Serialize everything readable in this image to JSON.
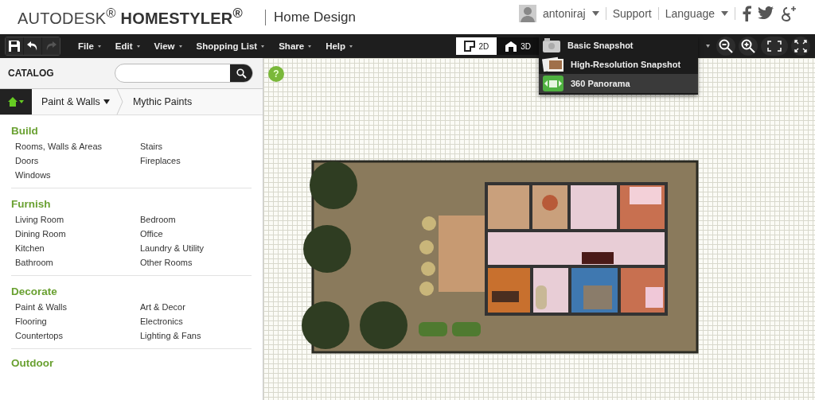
{
  "header": {
    "brand": "AUTODESK$^{®}$",
    "product": "HOMESTYLER$^{®}$",
    "app_name": "Home Design",
    "user": "antoniraj",
    "links": [
      {
        "label": "Support",
        "dropdown": false
      },
      {
        "label": "Language",
        "dropdown": true
      }
    ]
  },
  "toolbar": {
    "menus": [
      "File",
      "Edit",
      "View",
      "Shopping List",
      "Share",
      "Help"
    ],
    "view_modes": [
      {
        "label": "2D",
        "selected": true,
        "kind": "plan"
      },
      {
        "label": "3D",
        "selected": false,
        "kind": "house"
      }
    ]
  },
  "snapshot_menu": [
    {
      "label": "Basic Snapshot",
      "selected": false,
      "kind": "camera"
    },
    {
      "label": "High-Resolution Snapshot",
      "selected": false,
      "kind": "photo"
    },
    {
      "label": "360 Panorama",
      "selected": true,
      "kind": "panorama"
    }
  ],
  "catalog": {
    "title": "CATALOG",
    "breadcrumb": [
      "Paint & Walls",
      "Mythic Paints"
    ],
    "sections": [
      {
        "title": "Build",
        "items": [
          "Rooms, Walls & Areas",
          "Stairs",
          "Doors",
          "Fireplaces",
          "Windows"
        ]
      },
      {
        "title": "Furnish",
        "items": [
          "Living Room",
          "Bedroom",
          "Dining Room",
          "Office",
          "Kitchen",
          "Laundry & Utility",
          "Bathroom",
          "Other Rooms"
        ]
      },
      {
        "title": "Decorate",
        "items": [
          "Paint & Walls",
          "Art & Decor",
          "Flooring",
          "Electronics",
          "Countertops",
          "Lighting & Fans"
        ]
      },
      {
        "title": "Outdoor"
      }
    ]
  },
  "canvas": {
    "help_label": "?"
  }
}
